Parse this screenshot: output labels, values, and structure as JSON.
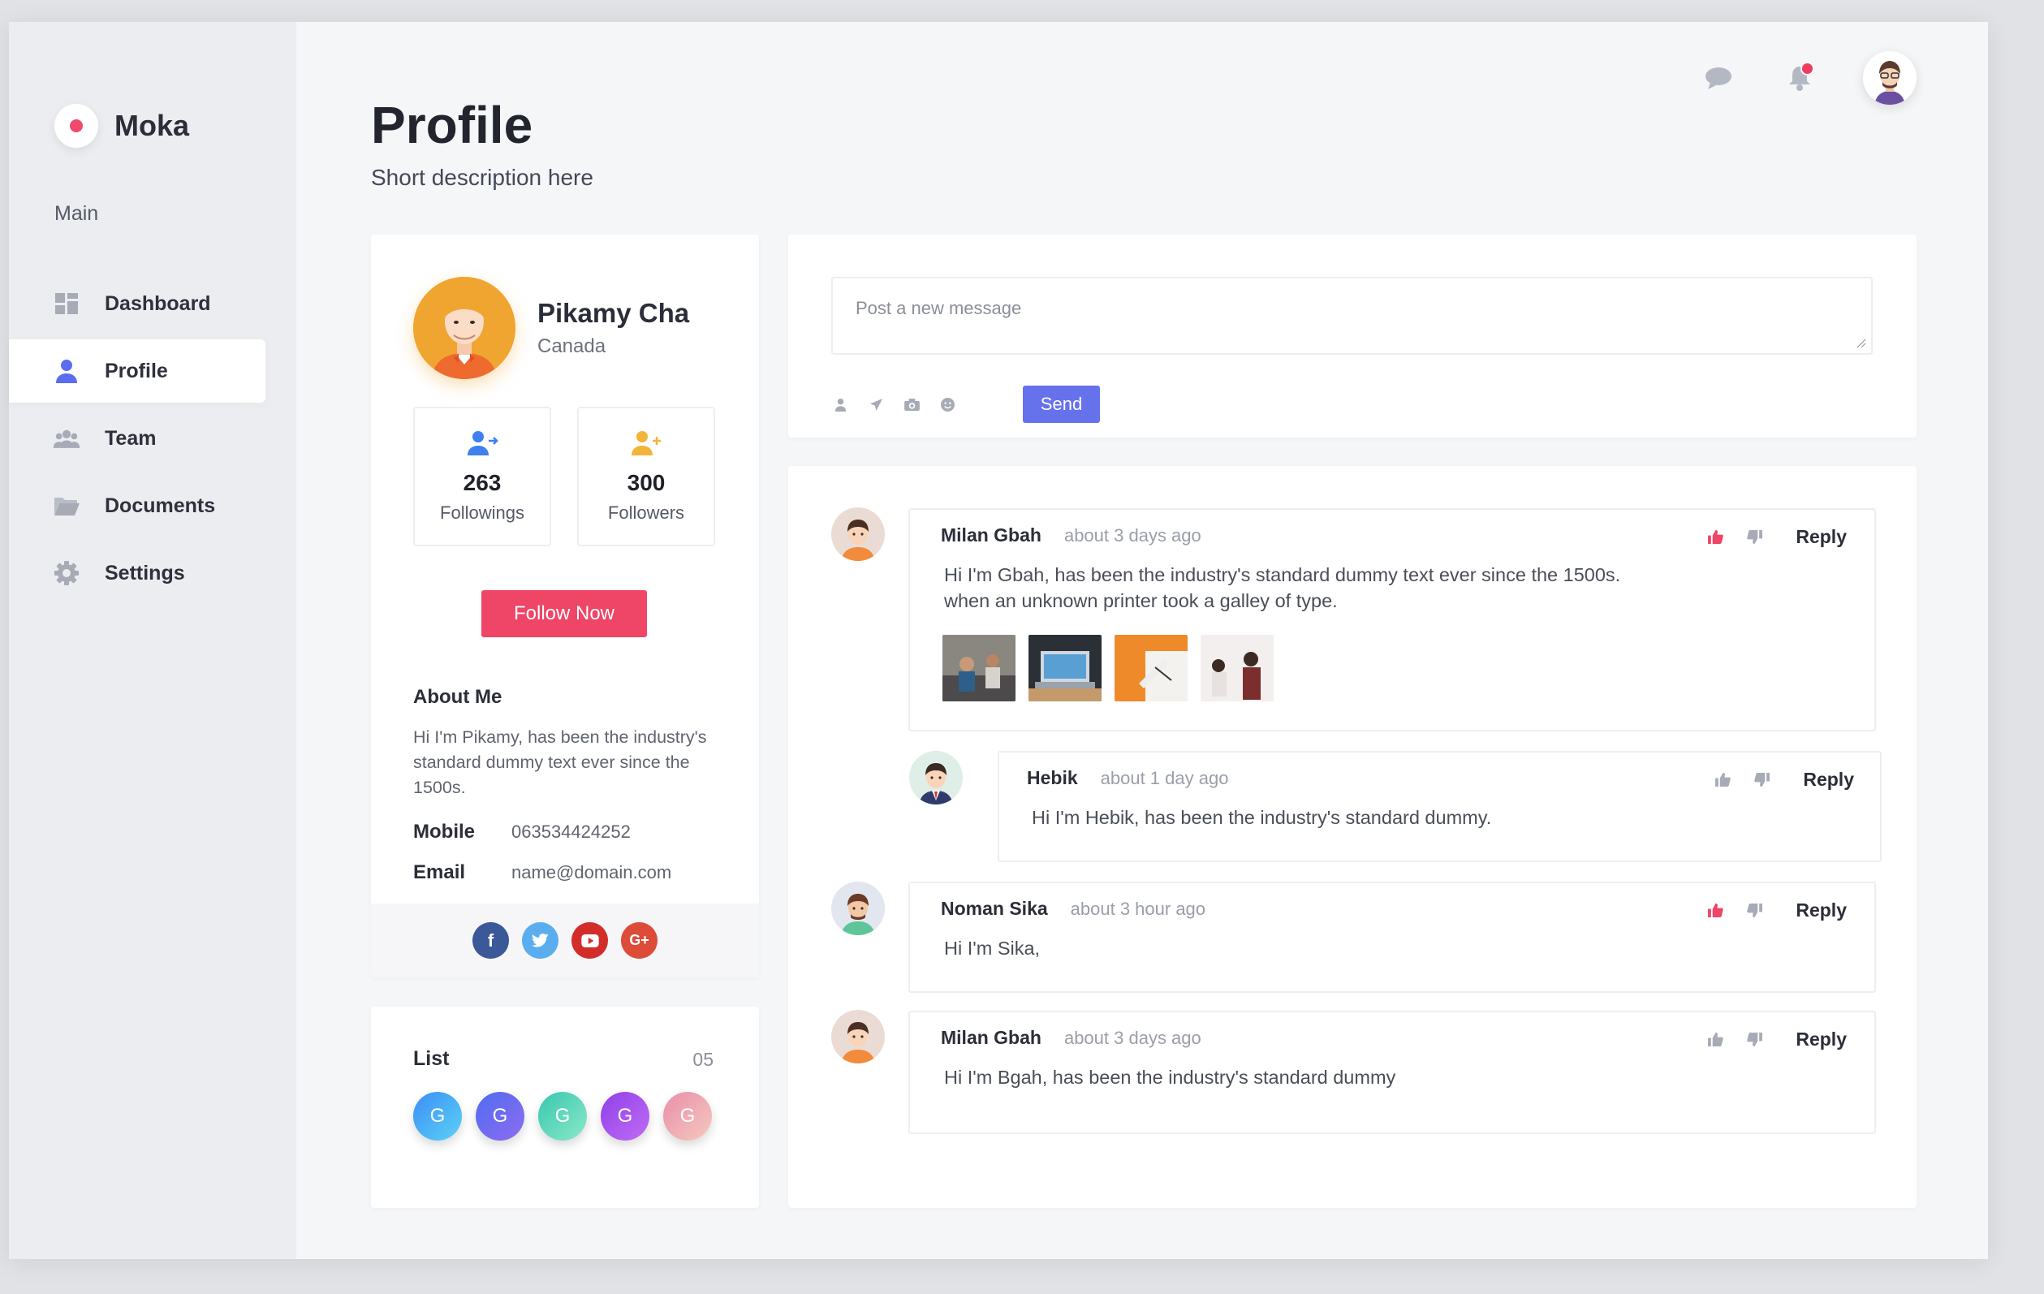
{
  "brand": {
    "name": "Moka",
    "accent": "#ef4a6b"
  },
  "sidebar": {
    "section": "Main",
    "items": [
      {
        "label": "Dashboard",
        "icon": "dashboard-icon",
        "active": false
      },
      {
        "label": "Profile",
        "icon": "user-icon",
        "active": true
      },
      {
        "label": "Team",
        "icon": "team-icon",
        "active": false
      },
      {
        "label": "Documents",
        "icon": "folder-icon",
        "active": false
      },
      {
        "label": "Settings",
        "icon": "gear-icon",
        "active": false
      }
    ]
  },
  "header": {
    "title": "Profile",
    "subtitle": "Short description here",
    "icons": [
      "chat-icon",
      "bell-icon",
      "user-avatar"
    ]
  },
  "profile": {
    "name": "Pikamy Cha",
    "country": "Canada",
    "followings_count": "263",
    "followings_label": "Followings",
    "followers_count": "300",
    "followers_label": "Followers",
    "follow_button": "Follow Now",
    "about_title": "About Me",
    "about_text": "Hi I'm Pikamy, has been the industry's standard dummy text ever since the 1500s.",
    "mobile_label": "Mobile",
    "mobile_value": "063534424252",
    "email_label": "Email",
    "email_value": "name@domain.com",
    "social": [
      "facebook",
      "twitter",
      "youtube",
      "google-plus"
    ]
  },
  "list": {
    "title": "List",
    "count": "05",
    "avatars": [
      "G",
      "G",
      "G",
      "G",
      "G"
    ]
  },
  "post": {
    "placeholder": "Post a new message",
    "send": "Send"
  },
  "comments": [
    {
      "author": "Milan Gbah",
      "time": "about 3 days ago",
      "text_line1": "Hi I'm Gbah, has been the industry's standard dummy text ever since the 1500s.",
      "text_line2": "when an unknown printer took a galley of type.",
      "liked": true,
      "reply": "Reply"
    },
    {
      "author": "Hebik",
      "time": "about 1 day ago",
      "text": "Hi I'm Hebik, has been the industry's standard dummy.",
      "liked": false,
      "reply": "Reply"
    },
    {
      "author": "Noman Sika",
      "time": "about 3 hour ago",
      "text": "Hi I'm Sika,",
      "liked": true,
      "reply": "Reply"
    },
    {
      "author": "Milan Gbah",
      "time": "about 3 days ago",
      "text": "Hi I'm Bgah, has been the industry's standard dummy",
      "liked": false,
      "reply": "Reply"
    }
  ]
}
